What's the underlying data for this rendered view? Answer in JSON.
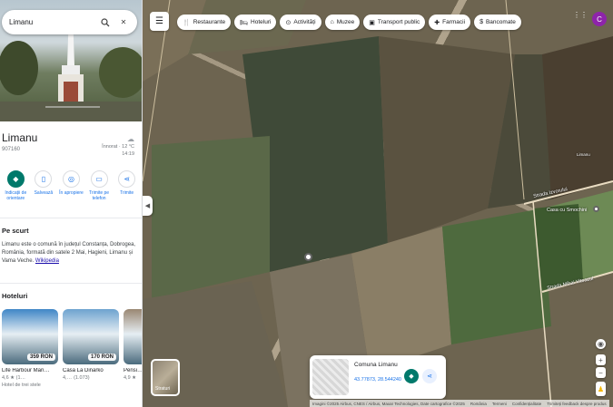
{
  "search": {
    "value": "Limanu"
  },
  "place": {
    "name": "Limanu",
    "postcode": "907160",
    "weather": {
      "condition": "Înnorat · 12 °C",
      "time": "14:19"
    }
  },
  "actions": [
    {
      "label": "Indicații de orientare",
      "icon": "directions-icon"
    },
    {
      "label": "Salvează",
      "icon": "bookmark-icon"
    },
    {
      "label": "În apropiere",
      "icon": "nearby-icon"
    },
    {
      "label": "Trimite pe telefon",
      "icon": "phone-icon"
    },
    {
      "label": "Trimite",
      "icon": "share-icon"
    }
  ],
  "overview": {
    "heading": "Pe scurt",
    "text": "Limanu este o comună în județul Constanța, Dobrogea, România, formată din satele 2 Mai, Hagieni, Limanu și Vama Veche.",
    "link": "Wikipedia"
  },
  "hotels": {
    "heading": "Hoteluri",
    "items": [
      {
        "name": "Life Harbour Mari…",
        "price": "359 RON",
        "rating": "4,6 ★ (1…",
        "type": "Hotel de trei stele",
        "color": "#3f86c6"
      },
      {
        "name": "Casa La Dinarko",
        "price": "170 RON",
        "rating": "4,…",
        "reviews": "(1.073)",
        "type": "",
        "color": "#6da3cf"
      },
      {
        "name": "Pensi…",
        "price": "",
        "rating": "4,9 ★",
        "type": "",
        "color": "#9a8772"
      }
    ]
  },
  "map": {
    "chips": [
      {
        "label": "Restaurante",
        "icon": "restaurant-icon"
      },
      {
        "label": "Hoteluri",
        "icon": "hotel-icon"
      },
      {
        "label": "Activități",
        "icon": "activity-icon"
      },
      {
        "label": "Muzee",
        "icon": "museum-icon"
      },
      {
        "label": "Transport public",
        "icon": "transit-icon"
      },
      {
        "label": "Farmacii",
        "icon": "pharmacy-icon"
      },
      {
        "label": "Bancomate",
        "icon": "atm-icon"
      }
    ],
    "avatar_letter": "C",
    "labels": {
      "casa": "Casa cu Smochini",
      "strada_a": "Strada Izvorului",
      "strada_b": "Strada Mihai Viteazul",
      "town": "Limanu"
    },
    "layers_label": "Straturi",
    "info_card": {
      "title": "Comuna Limanu",
      "coords": "43.77873, 28.544240"
    },
    "footer": [
      "Imagini ©2025 Airbus, CNES / Airbus, Maxar Technologies, Date cartografice ©2025",
      "România",
      "Termeni",
      "Confidențialitate",
      "Trimiteți feedback despre produs",
      "200 m"
    ]
  },
  "colors": {
    "accent": "#1a73e8",
    "primary_action": "#00796b",
    "avatar": "#8e24aa"
  }
}
